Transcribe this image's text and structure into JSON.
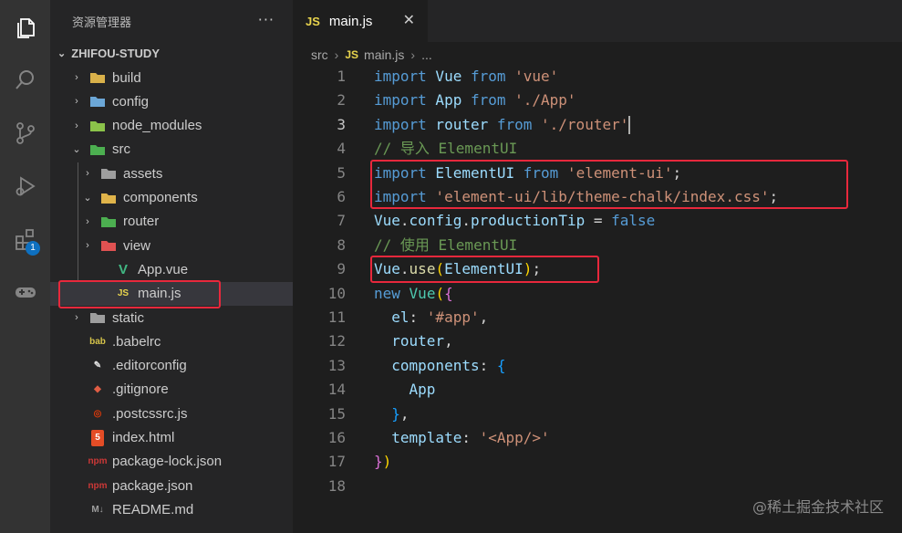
{
  "sidebar": {
    "title": "资源管理器",
    "more": "···",
    "project": "ZHIFOU-STUDY",
    "items": [
      {
        "label": "build",
        "twist": "›",
        "icon": "folder-build-icon",
        "color": "#d9b14a"
      },
      {
        "label": "config",
        "twist": "›",
        "icon": "folder-config-icon",
        "color": "#6ca7d7"
      },
      {
        "label": "node_modules",
        "twist": "›",
        "icon": "folder-node-icon",
        "color": "#8bc34a"
      },
      {
        "label": "src",
        "twist": "⌄",
        "icon": "folder-src-open-icon",
        "color": "#4caf50"
      },
      {
        "label": "assets",
        "twist": "›",
        "icon": "folder-assets-icon",
        "color": "#9e9e9e"
      },
      {
        "label": "components",
        "twist": "⌄",
        "icon": "folder-components-open-icon",
        "color": "#e0b44a"
      },
      {
        "label": "router",
        "twist": "›",
        "icon": "folder-router-icon",
        "color": "#4caf50"
      },
      {
        "label": "view",
        "twist": "›",
        "icon": "folder-view-icon",
        "color": "#e05252"
      },
      {
        "label": "App.vue",
        "twist": "",
        "icon": "vue-file-icon",
        "color": "#41b883"
      },
      {
        "label": "main.js",
        "twist": "",
        "icon": "js-file-icon",
        "color": "#e8d44d"
      },
      {
        "label": "static",
        "twist": "›",
        "icon": "folder-static-icon",
        "color": "#9e9e9e"
      },
      {
        "label": ".babelrc",
        "twist": "",
        "icon": "babel-file-icon",
        "color": "#d6c44a"
      },
      {
        "label": ".editorconfig",
        "twist": "",
        "icon": "editorconfig-file-icon",
        "color": "#e0e0e0"
      },
      {
        "label": ".gitignore",
        "twist": "",
        "icon": "git-file-icon",
        "color": "#e05d44"
      },
      {
        "label": ".postcssrc.js",
        "twist": "",
        "icon": "postcss-file-icon",
        "color": "#dd3a0a"
      },
      {
        "label": "index.html",
        "twist": "",
        "icon": "html-file-icon",
        "color": "#e44d26"
      },
      {
        "label": "package-lock.json",
        "twist": "",
        "icon": "npm-file-icon",
        "color": "#cb3837"
      },
      {
        "label": "package.json",
        "twist": "",
        "icon": "npm-file-icon",
        "color": "#cb3837"
      },
      {
        "label": "README.md",
        "twist": "",
        "icon": "markdown-file-icon",
        "color": "#9e9e9e"
      }
    ],
    "selected_index": 9
  },
  "activity": {
    "extensions_badge": "1"
  },
  "editor": {
    "tab_icon": "JS",
    "tab_label": "main.js",
    "tab_close": "✕",
    "breadcrumb": [
      "src",
      "main.js",
      "..."
    ],
    "lines": [
      {
        "n": "1"
      },
      {
        "n": "2"
      },
      {
        "n": "3"
      },
      {
        "n": "4"
      },
      {
        "n": "5"
      },
      {
        "n": "6"
      },
      {
        "n": "7"
      },
      {
        "n": "8"
      },
      {
        "n": "9"
      },
      {
        "n": "10"
      },
      {
        "n": "11"
      },
      {
        "n": "12"
      },
      {
        "n": "13"
      },
      {
        "n": "14"
      },
      {
        "n": "15"
      },
      {
        "n": "16"
      },
      {
        "n": "17"
      },
      {
        "n": "18"
      }
    ],
    "code": {
      "l1": [
        "import",
        " Vue ",
        "from",
        " 'vue'"
      ],
      "l2": [
        "import",
        " App ",
        "from",
        " './App'"
      ],
      "l3": [
        "import",
        " router ",
        "from",
        " './router'"
      ],
      "l4": "// 导入 ElementUI",
      "l5": [
        "import",
        " ElementUI ",
        "from",
        " 'element-ui'",
        ";"
      ],
      "l6": [
        "import",
        " 'element-ui/lib/theme-chalk/index.css'",
        ";"
      ],
      "l7": [
        "Vue",
        ".",
        "config",
        ".",
        "productionTip",
        " = ",
        "false"
      ],
      "l8": "// 使用 ElementUI",
      "l9": [
        "Vue",
        ".",
        "use",
        "(",
        "ElementUI",
        ")",
        ";"
      ],
      "l10": [
        "new",
        " ",
        "Vue",
        "(",
        "{"
      ],
      "l11": [
        "el",
        ": ",
        "'#app'",
        ","
      ],
      "l12": [
        "router",
        ","
      ],
      "l13": [
        "components",
        ": ",
        "{"
      ],
      "l14": "App",
      "l15": [
        "}",
        ","
      ],
      "l16": [
        "template",
        ": ",
        "'<App/>'"
      ],
      "l17": [
        "}",
        ")"
      ]
    }
  },
  "watermark": "@稀土掘金技术社区",
  "colors": {
    "highlight": "#e8283c",
    "keyword": "#569cd6",
    "string": "#ce9178",
    "comment": "#6a9955"
  }
}
